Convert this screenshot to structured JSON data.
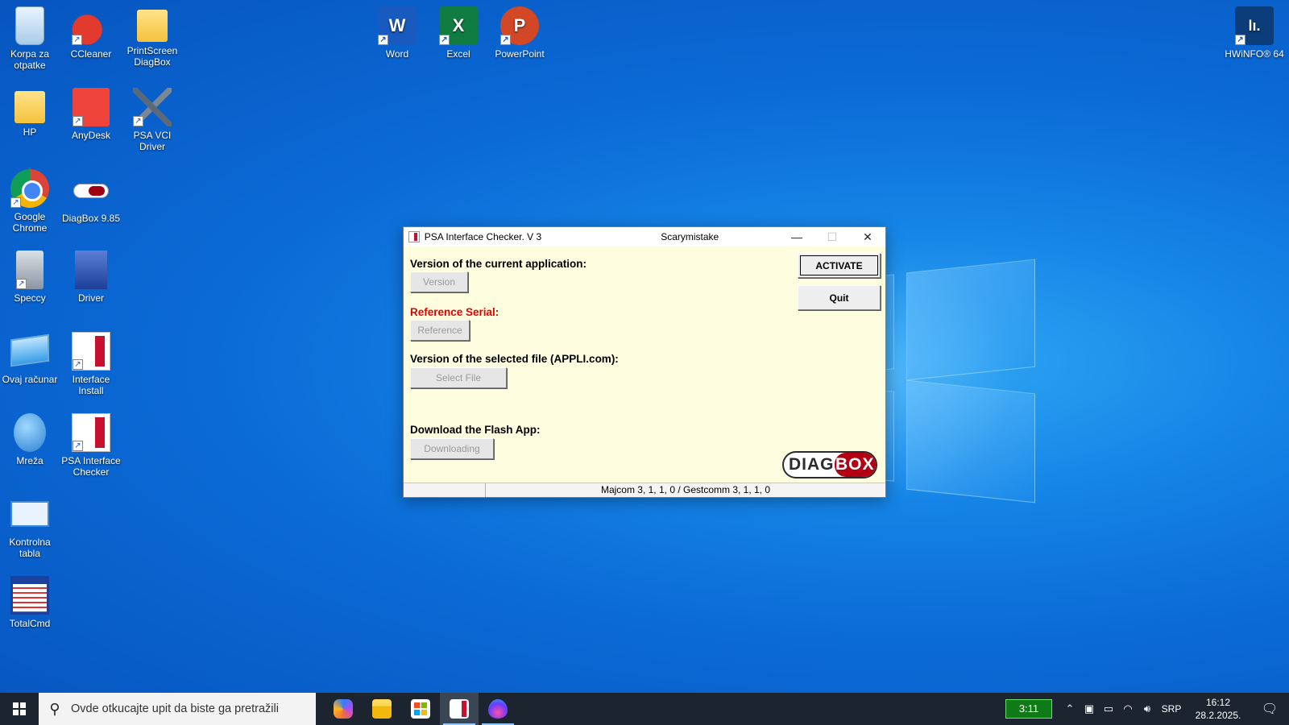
{
  "desktop": {
    "icons": [
      {
        "label": "Korpa za otpatke",
        "icon": "recycle-bin-icon"
      },
      {
        "label": "CCleaner",
        "icon": "ccleaner-icon"
      },
      {
        "label": "PrintScreen DiagBox",
        "icon": "folder-icon"
      },
      {
        "label": "HP",
        "icon": "user-folder-icon"
      },
      {
        "label": "AnyDesk",
        "icon": "anydesk-icon"
      },
      {
        "label": "PSA VCI Driver",
        "icon": "tools-icon"
      },
      {
        "label": "Google Chrome",
        "icon": "chrome-icon"
      },
      {
        "label": "DiagBox 9.85",
        "icon": "diagbox-icon"
      },
      {
        "label": "Speccy",
        "icon": "speccy-icon"
      },
      {
        "label": "Driver",
        "icon": "driver-icon"
      },
      {
        "label": "Ovaj računar",
        "icon": "computer-icon"
      },
      {
        "label": "Interface Install",
        "icon": "psa-app-icon"
      },
      {
        "label": "Mreža",
        "icon": "network-icon"
      },
      {
        "label": "PSA Interface Checker",
        "icon": "psa-app-icon"
      },
      {
        "label": "Kontrolna tabla",
        "icon": "control-panel-icon"
      },
      {
        "label": "TotalCmd",
        "icon": "totalcmd-icon"
      },
      {
        "label": "Word",
        "icon": "word-icon",
        "glyph": "W"
      },
      {
        "label": "Excel",
        "icon": "excel-icon",
        "glyph": "X"
      },
      {
        "label": "PowerPoint",
        "icon": "powerpoint-icon",
        "glyph": "P"
      },
      {
        "label": "HWiNFO® 64",
        "icon": "hwinfo-icon",
        "glyph": "lı."
      }
    ]
  },
  "window": {
    "title": "PSA Interface Checker. V 3",
    "user": "Scarymistake",
    "controls": {
      "minimize": "—",
      "maximize": "☐",
      "close": "✕"
    },
    "version_label": "Version of the current application:",
    "version_button": "Version",
    "reference_label": "Reference Serial:",
    "reference_button": "Reference",
    "file_label": "Version of the selected file (APPLI.com):",
    "file_button": "Select File",
    "flash_label": "Download the Flash App:",
    "flash_button": "Downloading",
    "activate_button": "ACTIVATE",
    "quit_button": "Quit",
    "logo_left": "DIAG",
    "logo_right": "BOX",
    "status_left": "",
    "status_right": "Majcom 3, 1, 1, 0 / Gestcomm 3, 1, 1, 0",
    "reference_color": "#e60000"
  },
  "taskbar": {
    "search_placeholder": "Ovde otkucajte upit da biste ga pretražili",
    "battery_time": "3:11",
    "language": "SRP",
    "time": "16:12",
    "date": "28.2.2025.",
    "apps": [
      "copilot-icon",
      "file-explorer-icon",
      "store-icon",
      "psa-interface-checker-icon",
      "drop-app-icon"
    ]
  }
}
